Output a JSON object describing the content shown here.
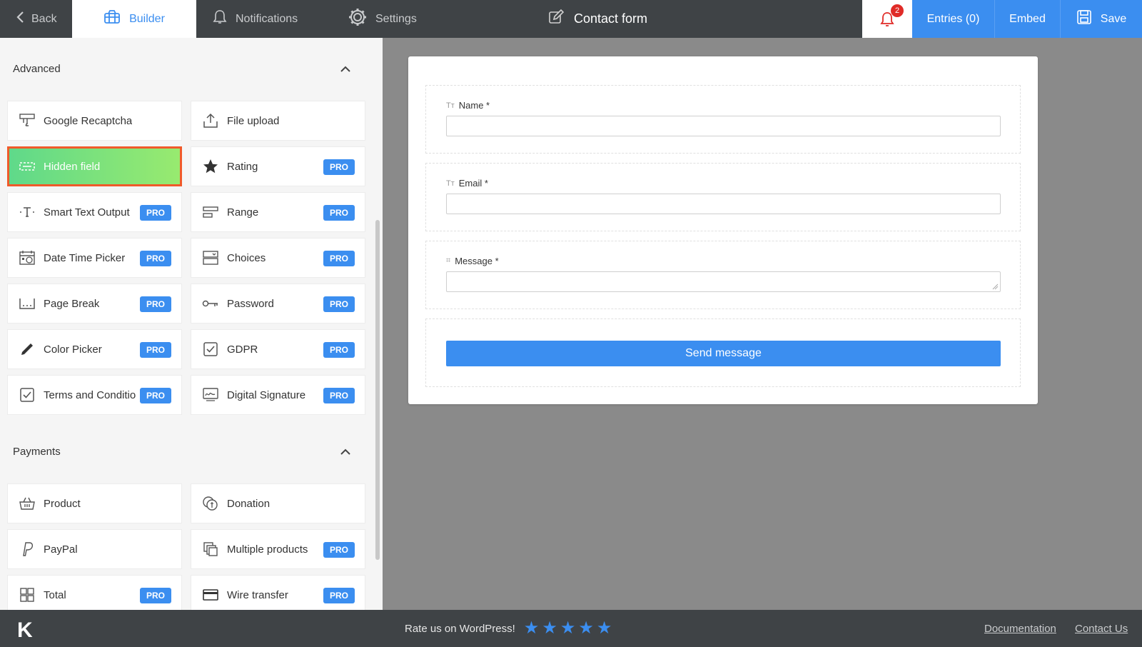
{
  "topbar": {
    "back": "Back",
    "builder": "Builder",
    "notifications": "Notifications",
    "settings": "Settings",
    "form_title": "Contact form",
    "bell_count": "2",
    "entries": "Entries (0)",
    "embed": "Embed",
    "save": "Save"
  },
  "sidebar": {
    "advanced": {
      "title": "Advanced",
      "items": [
        {
          "label": "Google Recaptcha",
          "icon": "recaptcha-icon",
          "pro": ""
        },
        {
          "label": "File upload",
          "icon": "upload-icon",
          "pro": ""
        },
        {
          "label": "Hidden field",
          "icon": "hidden-field-icon",
          "pro": ""
        },
        {
          "label": "Rating",
          "icon": "star-icon",
          "pro": "PRO"
        },
        {
          "label": "Smart Text Output",
          "icon": "text-output-icon",
          "pro": "PRO"
        },
        {
          "label": "Range",
          "icon": "range-icon",
          "pro": "PRO"
        },
        {
          "label": "Date Time Picker",
          "icon": "calendar-icon",
          "pro": "PRO"
        },
        {
          "label": "Choices",
          "icon": "choices-icon",
          "pro": "PRO"
        },
        {
          "label": "Page Break",
          "icon": "page-break-icon",
          "pro": "PRO"
        },
        {
          "label": "Password",
          "icon": "key-icon",
          "pro": "PRO"
        },
        {
          "label": "Color Picker",
          "icon": "pen-icon",
          "pro": "PRO"
        },
        {
          "label": "GDPR",
          "icon": "checkbox-icon",
          "pro": "PRO"
        },
        {
          "label": "Terms and Conditio",
          "icon": "checkbox-icon",
          "pro": "PRO"
        },
        {
          "label": "Digital Signature",
          "icon": "signature-icon",
          "pro": "PRO"
        }
      ]
    },
    "payments": {
      "title": "Payments",
      "items": [
        {
          "label": "Product",
          "icon": "basket-icon",
          "pro": ""
        },
        {
          "label": "Donation",
          "icon": "donation-icon",
          "pro": ""
        },
        {
          "label": "PayPal",
          "icon": "paypal-icon",
          "pro": ""
        },
        {
          "label": "Multiple products",
          "icon": "multi-products-icon",
          "pro": "PRO"
        },
        {
          "label": "Total",
          "icon": "total-icon",
          "pro": "PRO"
        },
        {
          "label": "Wire transfer",
          "icon": "card-icon",
          "pro": "PRO"
        }
      ]
    }
  },
  "form": {
    "fields": [
      {
        "label": "Name *",
        "type": "text"
      },
      {
        "label": "Email *",
        "type": "text"
      },
      {
        "label": "Message *",
        "type": "textarea"
      }
    ],
    "submit": "Send message"
  },
  "footer": {
    "logo": "K",
    "rate": "Rate us on WordPress!",
    "stars": 5,
    "documentation": "Documentation",
    "contact": "Contact Us"
  },
  "colors": {
    "accent": "#3b8ef0",
    "topbar": "#3f4346",
    "highlight_border": "#f05a2a",
    "badge": "#e02b27"
  }
}
